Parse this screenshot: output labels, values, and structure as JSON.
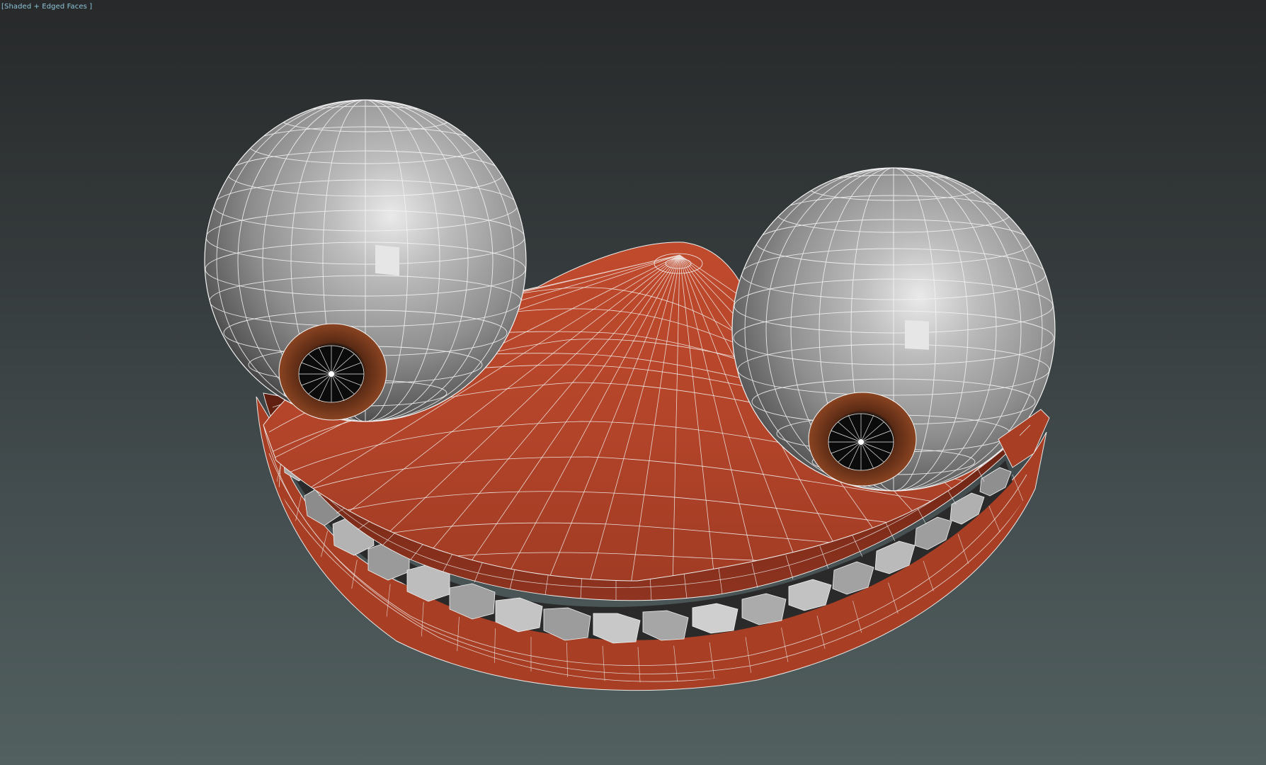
{
  "viewport": {
    "label": "[Shaded + Edged Faces ]",
    "background_top": "#27292a",
    "background_bottom": "#52605f"
  },
  "model": {
    "parts": [
      "eyeball-left",
      "eyeball-right",
      "upper-lip",
      "lower-lip",
      "teeth"
    ],
    "skin_color": "#b4452a",
    "skin_shadow_color": "#7a2a18",
    "eye_color": "#9a9a9a",
    "iris_color": "#7a3a1c",
    "pupil_color": "#111111",
    "tooth_color": "#a8a8a8",
    "wire_color": "#f2f2f2"
  }
}
